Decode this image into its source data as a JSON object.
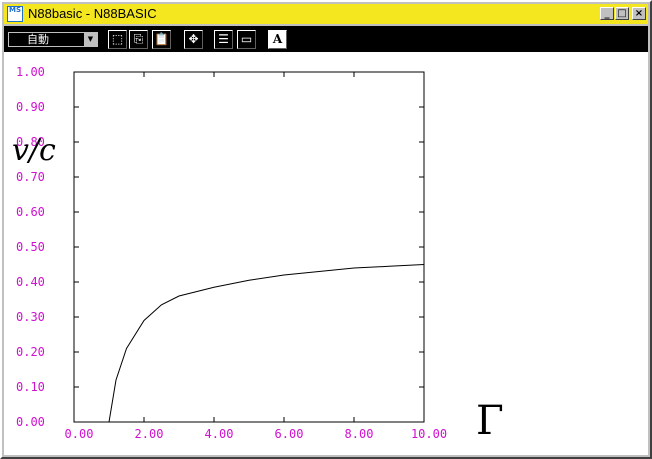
{
  "window": {
    "title": "N88basic - N88BASIC",
    "icon_text": "MS",
    "buttons": {
      "minimize": "_",
      "maximize": "□",
      "close": "×"
    }
  },
  "toolbar": {
    "mode_value": "自動",
    "tools": [
      {
        "name": "select-icon",
        "glyph": "⬚"
      },
      {
        "name": "copy-icon",
        "glyph": "⎘"
      },
      {
        "name": "paste-icon",
        "glyph": "📋"
      },
      {
        "name": "fit-icon",
        "glyph": "✥"
      },
      {
        "name": "properties-icon",
        "glyph": "☰"
      },
      {
        "name": "window-icon",
        "glyph": "▭"
      },
      {
        "name": "font-icon",
        "glyph": "A"
      }
    ]
  },
  "colors": {
    "tick_label": "#d010d0",
    "title_bar": "#f4e61f",
    "curve": "#000000"
  },
  "chart_data": {
    "type": "line",
    "ylabel": "v/c",
    "xlabel": "Γ",
    "xlim": [
      0,
      10
    ],
    "ylim": [
      0,
      1
    ],
    "x_ticks": [
      "0.00",
      "2.00",
      "4.00",
      "6.00",
      "8.00",
      "10.00"
    ],
    "y_ticks": [
      "0.00",
      "0.10",
      "0.20",
      "0.30",
      "0.40",
      "0.50",
      "0.60",
      "0.70",
      "0.80",
      "0.90",
      "1.00"
    ],
    "series": [
      {
        "x": [
          1.0,
          1.2,
          1.5,
          2.0,
          2.5,
          3.0,
          4.0,
          5.0,
          6.0,
          7.0,
          8.0,
          9.0,
          10.0
        ],
        "y": [
          0.0,
          0.12,
          0.21,
          0.29,
          0.335,
          0.36,
          0.385,
          0.405,
          0.42,
          0.43,
          0.44,
          0.445,
          0.45
        ]
      }
    ]
  }
}
